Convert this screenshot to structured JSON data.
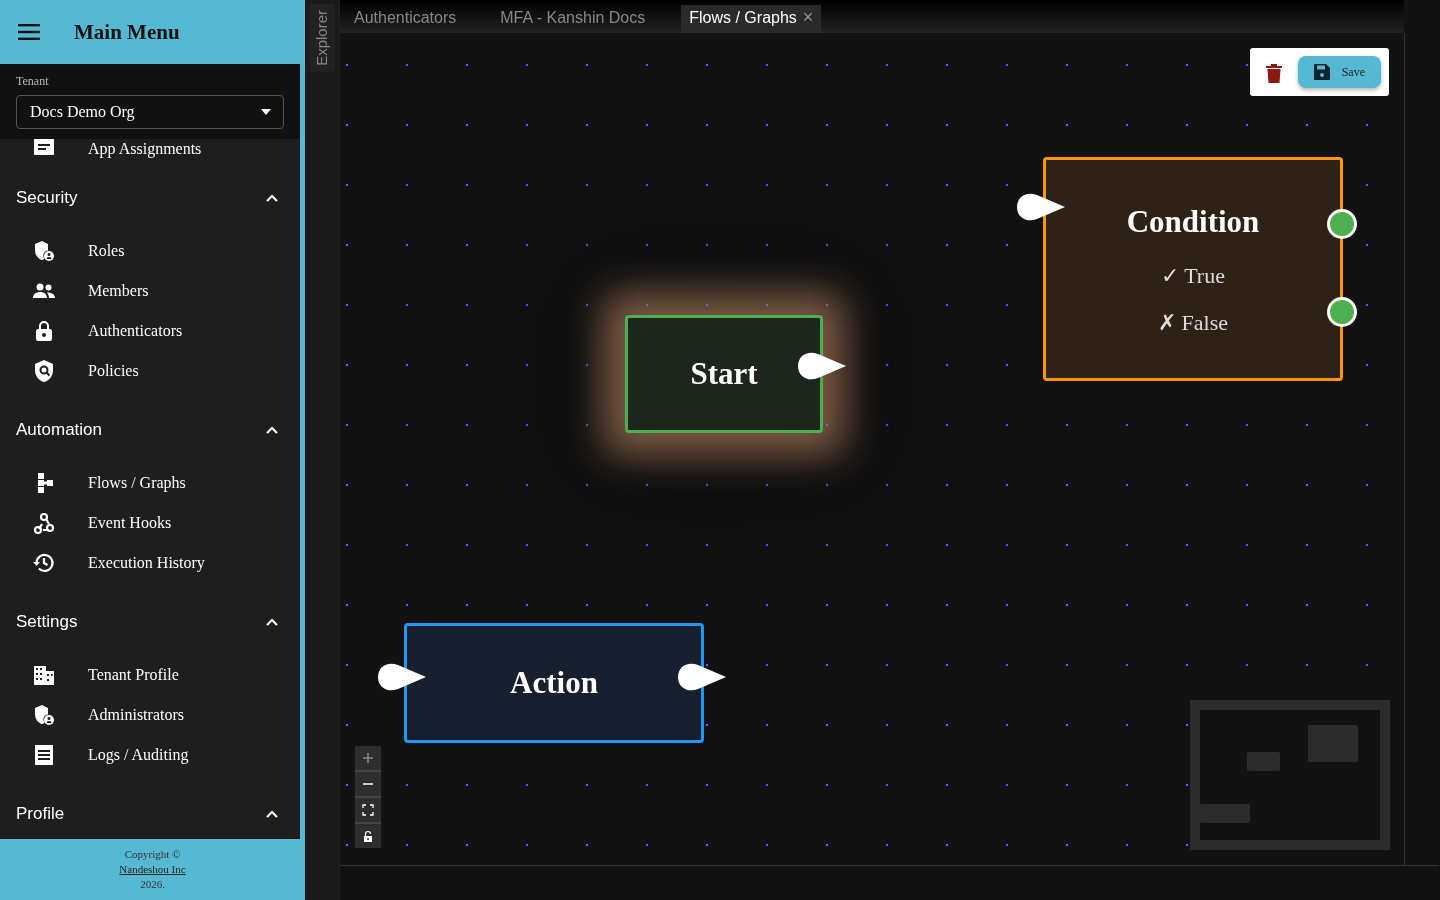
{
  "sidebar": {
    "title": "Main Menu",
    "tenant": {
      "label": "Tenant",
      "value": "Docs Demo Org"
    },
    "partial_item": "App Assignments",
    "sections": [
      {
        "title": "Security",
        "expanded": true,
        "items": [
          "Roles",
          "Members",
          "Authenticators",
          "Policies"
        ]
      },
      {
        "title": "Automation",
        "expanded": true,
        "items": [
          "Flows / Graphs",
          "Event Hooks",
          "Execution History"
        ]
      },
      {
        "title": "Settings",
        "expanded": true,
        "items": [
          "Tenant Profile",
          "Administrators",
          "Logs / Auditing"
        ]
      },
      {
        "title": "Profile",
        "expanded": true
      }
    ],
    "footer": {
      "copyright": "Copyright ©",
      "company": "Nandeshou Inc",
      "year": "2026."
    }
  },
  "explorer": {
    "label": "Explorer"
  },
  "tabs": [
    {
      "label": "Authenticators",
      "selected": false,
      "closable": false
    },
    {
      "label": "MFA - Kanshin Docs",
      "selected": false,
      "closable": false
    },
    {
      "label": "Flows / Graphs",
      "selected": true,
      "closable": true,
      "close": "×"
    }
  ],
  "toolbar": {
    "save": "Save"
  },
  "nodes": [
    {
      "kind": "start",
      "title": "Start",
      "color": "#4caf50",
      "highlighted": true
    },
    {
      "kind": "condition",
      "title": "Condition",
      "color": "#ff9800",
      "highlighted": false,
      "outputs": [
        "✓ True",
        "✗ False"
      ]
    },
    {
      "kind": "action",
      "title": "Action",
      "color": "#2196f3",
      "highlighted": false
    }
  ]
}
